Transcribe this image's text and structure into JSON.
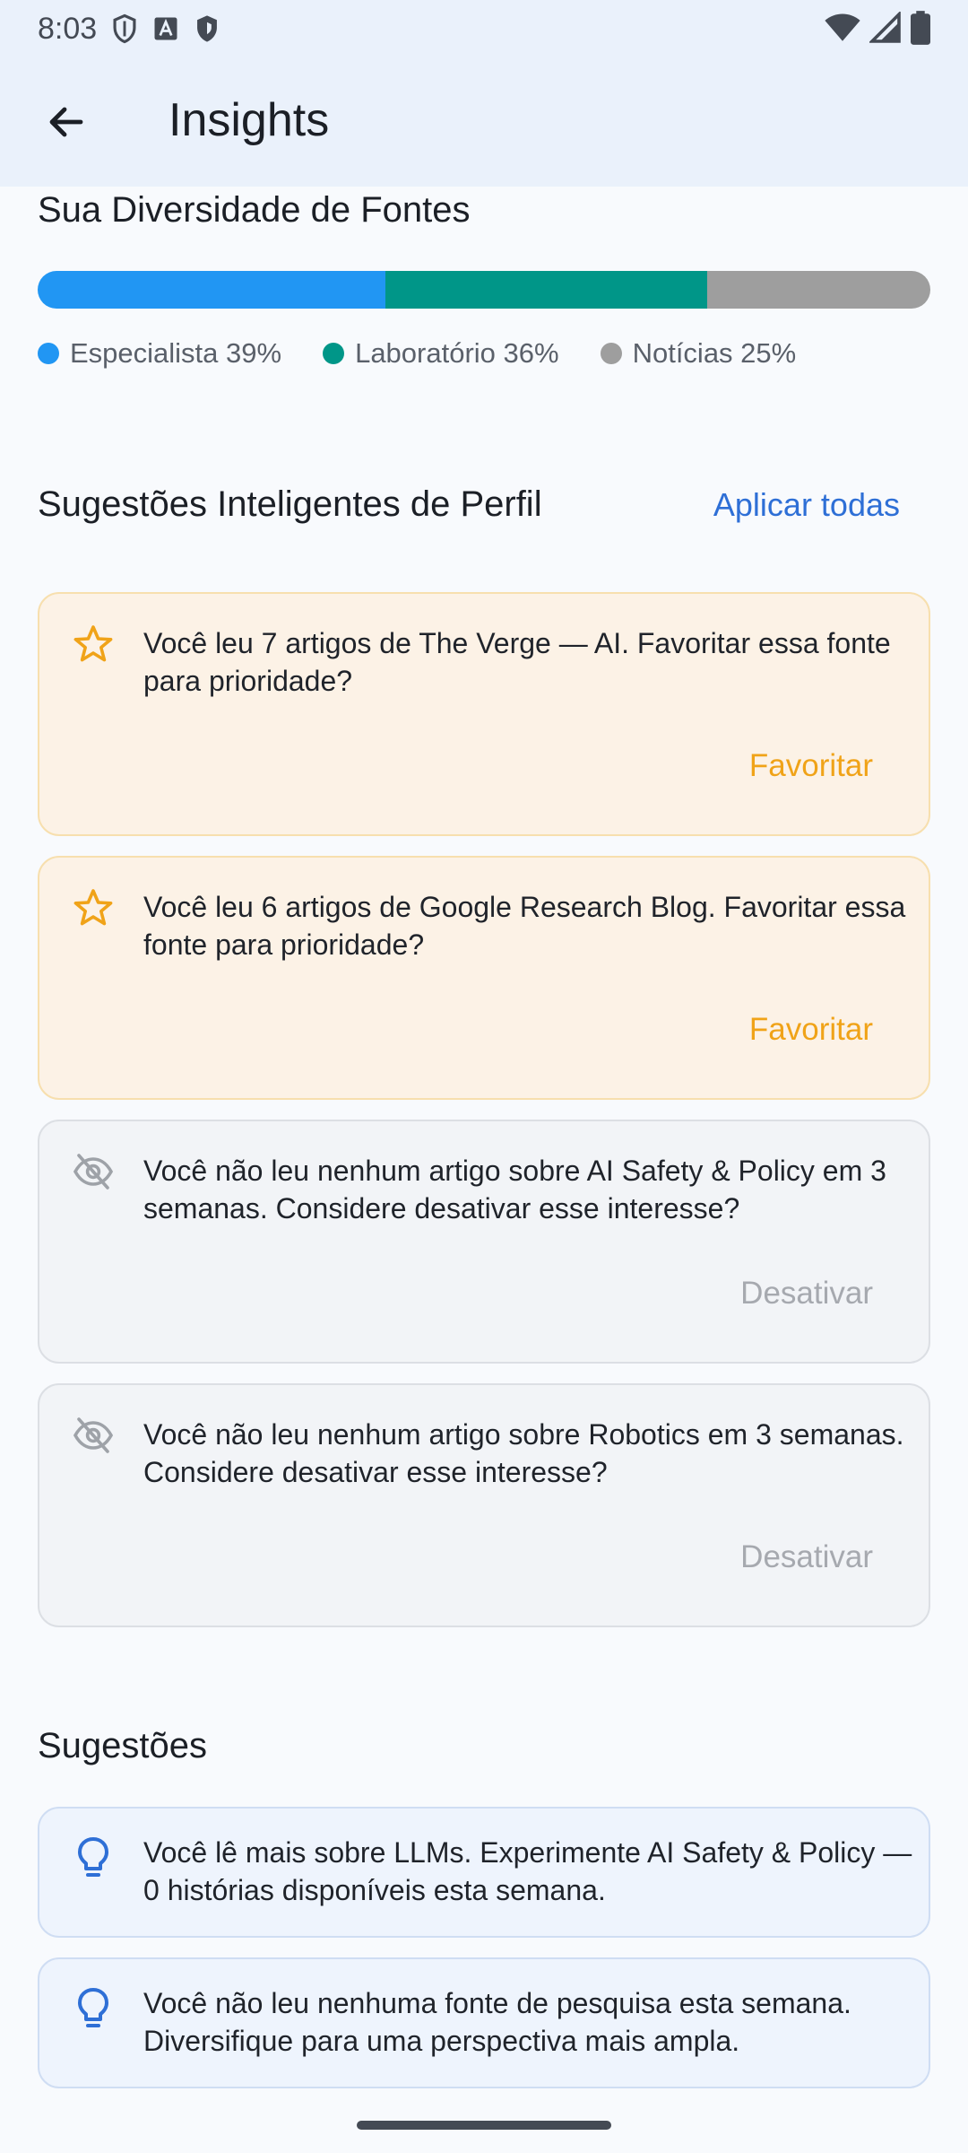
{
  "status_bar": {
    "time": "8:03"
  },
  "app_bar": {
    "title": "Insights"
  },
  "diversity": {
    "title": "Sua Diversidade de Fontes",
    "segments": [
      {
        "label": "Especialista 39%",
        "percent": 39,
        "color": "#2196F3"
      },
      {
        "label": "Laboratório 36%",
        "percent": 36,
        "color": "#009688"
      },
      {
        "label": "Notícias 25%",
        "percent": 25,
        "color": "#9E9E9E"
      }
    ]
  },
  "smart": {
    "title": "Sugestões Inteligentes de Perfil",
    "apply_all": "Aplicar todas",
    "cards": [
      {
        "text": "Você leu 7 artigos de The Verge — AI. Favoritar essa fonte para prioridade?",
        "action": "Favoritar",
        "icon": "star-icon"
      },
      {
        "text": "Você leu 6 artigos de Google Research Blog. Favoritar essa fonte para prioridade?",
        "action": "Favoritar",
        "icon": "star-icon"
      },
      {
        "text": "Você não leu nenhum artigo sobre AI Safety & Policy em 3 semanas. Considere desativar esse interesse?",
        "action": "Desativar",
        "icon": "eye-off-icon"
      },
      {
        "text": "Você não leu nenhum artigo sobre Robotics em 3 semanas. Considere desativar esse interesse?",
        "action": "Desativar",
        "icon": "eye-off-icon"
      }
    ]
  },
  "suggestions": {
    "title": "Sugestões",
    "items": [
      {
        "text": "Você lê mais sobre LLMs. Experimente AI Safety & Policy — 0 histórias disponíveis esta semana.",
        "icon": "lightbulb-icon"
      },
      {
        "text": "Você não leu nenhuma fonte de pesquisa esta semana. Diversifique para uma perspectiva mais ampla.",
        "icon": "lightbulb-icon"
      }
    ]
  },
  "colors": {
    "accent": "#2E6FD6",
    "favorite": "#F0A318",
    "disabled": "#A6A9AF"
  }
}
